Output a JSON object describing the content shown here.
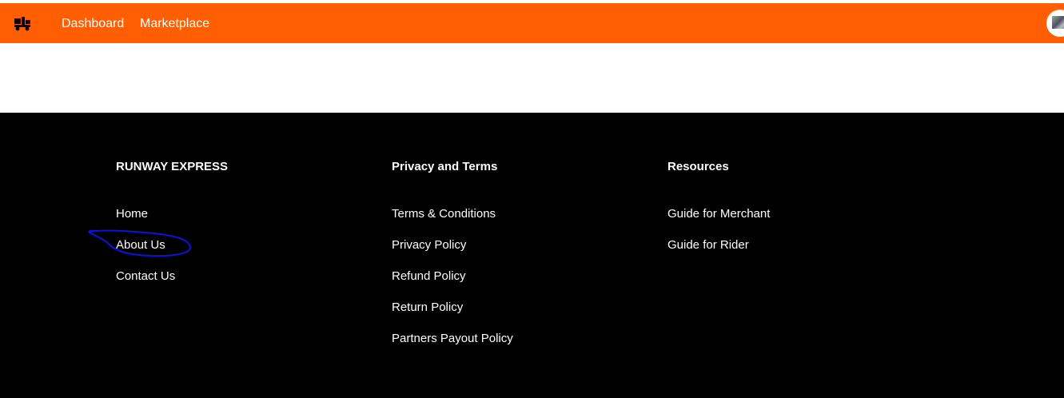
{
  "navbar": {
    "background": "#FF5E03",
    "logo_icon": "delivery-truck-icon",
    "links": [
      "Dashboard",
      "Marketplace"
    ],
    "avatar_icon": "user-avatar"
  },
  "footer": {
    "background": "#000000",
    "columns": [
      {
        "heading": "RUNWAY EXPRESS",
        "links": [
          "Home",
          "About Us",
          "Contact Us"
        ]
      },
      {
        "heading": "Privacy and Terms",
        "links": [
          "Terms & Conditions",
          "Privacy Policy",
          "Refund Policy",
          "Return Policy",
          "Partners Payout Policy"
        ]
      },
      {
        "heading": "Resources",
        "links": [
          "Guide for Merchant",
          "Guide for Rider"
        ]
      }
    ],
    "annotation_color": "#0A14D8"
  }
}
